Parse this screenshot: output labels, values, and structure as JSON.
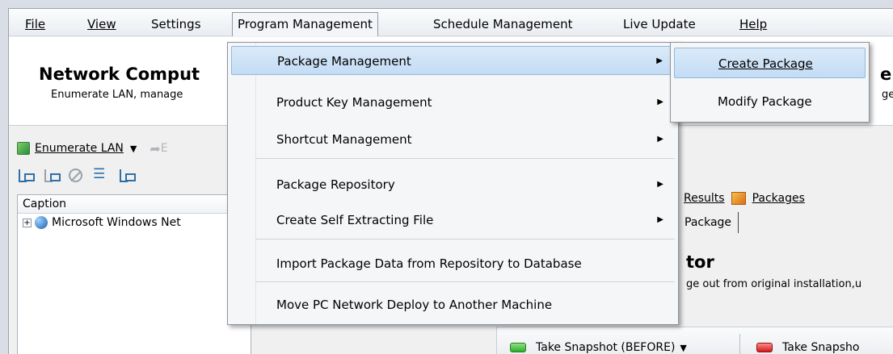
{
  "menubar": {
    "items": [
      {
        "label": "File"
      },
      {
        "label": "View"
      },
      {
        "label": "Settings"
      },
      {
        "label": "Program Management"
      },
      {
        "label": "Schedule Management"
      },
      {
        "label": "Live Update"
      },
      {
        "label": "Help"
      }
    ]
  },
  "header": {
    "title": "Network Comput",
    "subtitle": "Enumerate LAN, manage",
    "title_right": "em",
    "subtitle_right": "ge"
  },
  "toolbar": {
    "enumerate_label": "Enumerate LAN",
    "enumerate_icon": "refresh-icon",
    "forward_label": "E"
  },
  "tree": {
    "column_header": "Caption",
    "root_label": "Microsoft Windows Net"
  },
  "right": {
    "tabs": [
      {
        "label": "Results"
      },
      {
        "label": "Packages"
      }
    ],
    "subtab": "Package",
    "wizard_title": "tor",
    "wizard_desc": "ge out from original installation,u",
    "snapshot_before": "Take Snapshot (BEFORE)",
    "snapshot_after": "Take Snapsho"
  },
  "program_menu": {
    "items": [
      {
        "label": "Package Management",
        "has_submenu": true,
        "highlighted": true
      },
      {
        "label": "Product Key Management",
        "has_submenu": true
      },
      {
        "label": "Shortcut Management",
        "has_submenu": true
      },
      {
        "label": "Package Repository",
        "has_submenu": true
      },
      {
        "label": "Create Self Extracting File",
        "has_submenu": true
      },
      {
        "label": "Import Package Data from Repository to Database",
        "has_submenu": false
      },
      {
        "label": "Move PC Network Deploy to Another Machine",
        "has_submenu": false
      }
    ]
  },
  "package_submenu": {
    "items": [
      {
        "label": "Create Package",
        "highlighted": true
      },
      {
        "label": "Modify Package"
      }
    ]
  },
  "colors": {
    "highlight": "#c3dcf5",
    "menu_bg": "#f5f6f7",
    "led_green": "#2fae2c",
    "led_red": "#d01a1a"
  }
}
